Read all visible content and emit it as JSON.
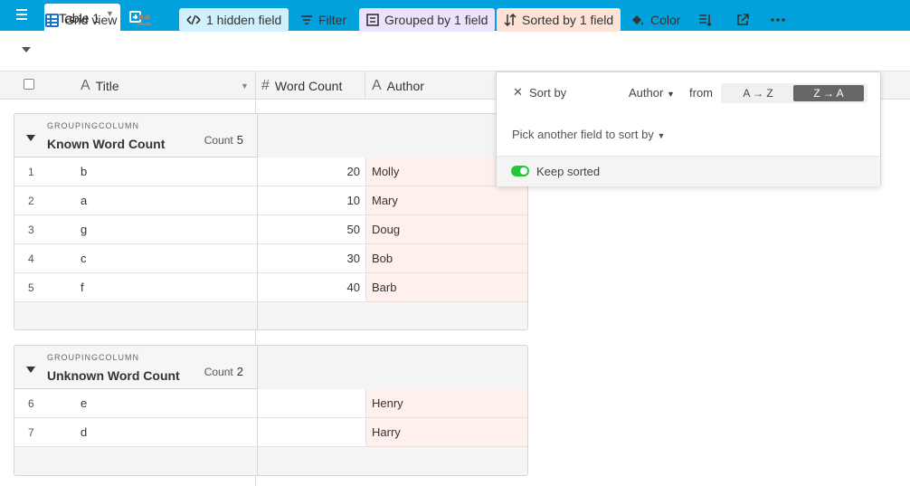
{
  "app": {
    "accent_color": "#00a1dc",
    "tab": {
      "label": "Table 1"
    }
  },
  "toolbar": {
    "view_label": "Grid view",
    "hidden_fields": "1 hidden field",
    "filter": "Filter",
    "grouped": "Grouped by 1 field",
    "sorted": "Sorted by 1 field",
    "color": "Color",
    "icons": [
      "menu-icon",
      "add-tab-icon",
      "grid-icon",
      "people-icon",
      "hide-icon",
      "filter-icon",
      "group-icon",
      "sort-icon",
      "paint-icon",
      "row-height-icon",
      "share-icon",
      "more-icon"
    ]
  },
  "columns": {
    "title": "Title",
    "word_count": "Word Count",
    "author": "Author",
    "title_icon": "A",
    "word_count_icon": "#",
    "author_icon": "A"
  },
  "groups": [
    {
      "column_label": "GROUPINGCOLUMN",
      "name": "Known Word Count",
      "count_label": "Count",
      "count": "5",
      "rows": [
        {
          "num": "1",
          "title": "b",
          "word_count": "20",
          "author": "Molly"
        },
        {
          "num": "2",
          "title": "a",
          "word_count": "10",
          "author": "Mary"
        },
        {
          "num": "3",
          "title": "g",
          "word_count": "50",
          "author": "Doug"
        },
        {
          "num": "4",
          "title": "c",
          "word_count": "30",
          "author": "Bob"
        },
        {
          "num": "5",
          "title": "f",
          "word_count": "40",
          "author": "Barb"
        }
      ]
    },
    {
      "column_label": "GROUPINGCOLUMN",
      "name": "Unknown Word Count",
      "count_label": "Count",
      "count": "2",
      "rows": [
        {
          "num": "6",
          "title": "e",
          "word_count": "",
          "author": "Henry"
        },
        {
          "num": "7",
          "title": "d",
          "word_count": "",
          "author": "Harry"
        }
      ]
    }
  ],
  "sort_popover": {
    "close": "✕",
    "sort_by": "Sort by",
    "field": "Author",
    "from": "from",
    "options": [
      "A → Z",
      "Z → A"
    ],
    "active_option": "Z → A",
    "pick_another": "Pick another field to sort by",
    "keep_sorted": "Keep sorted",
    "keep_sorted_on": true,
    "toggle_color": "#20c933"
  }
}
